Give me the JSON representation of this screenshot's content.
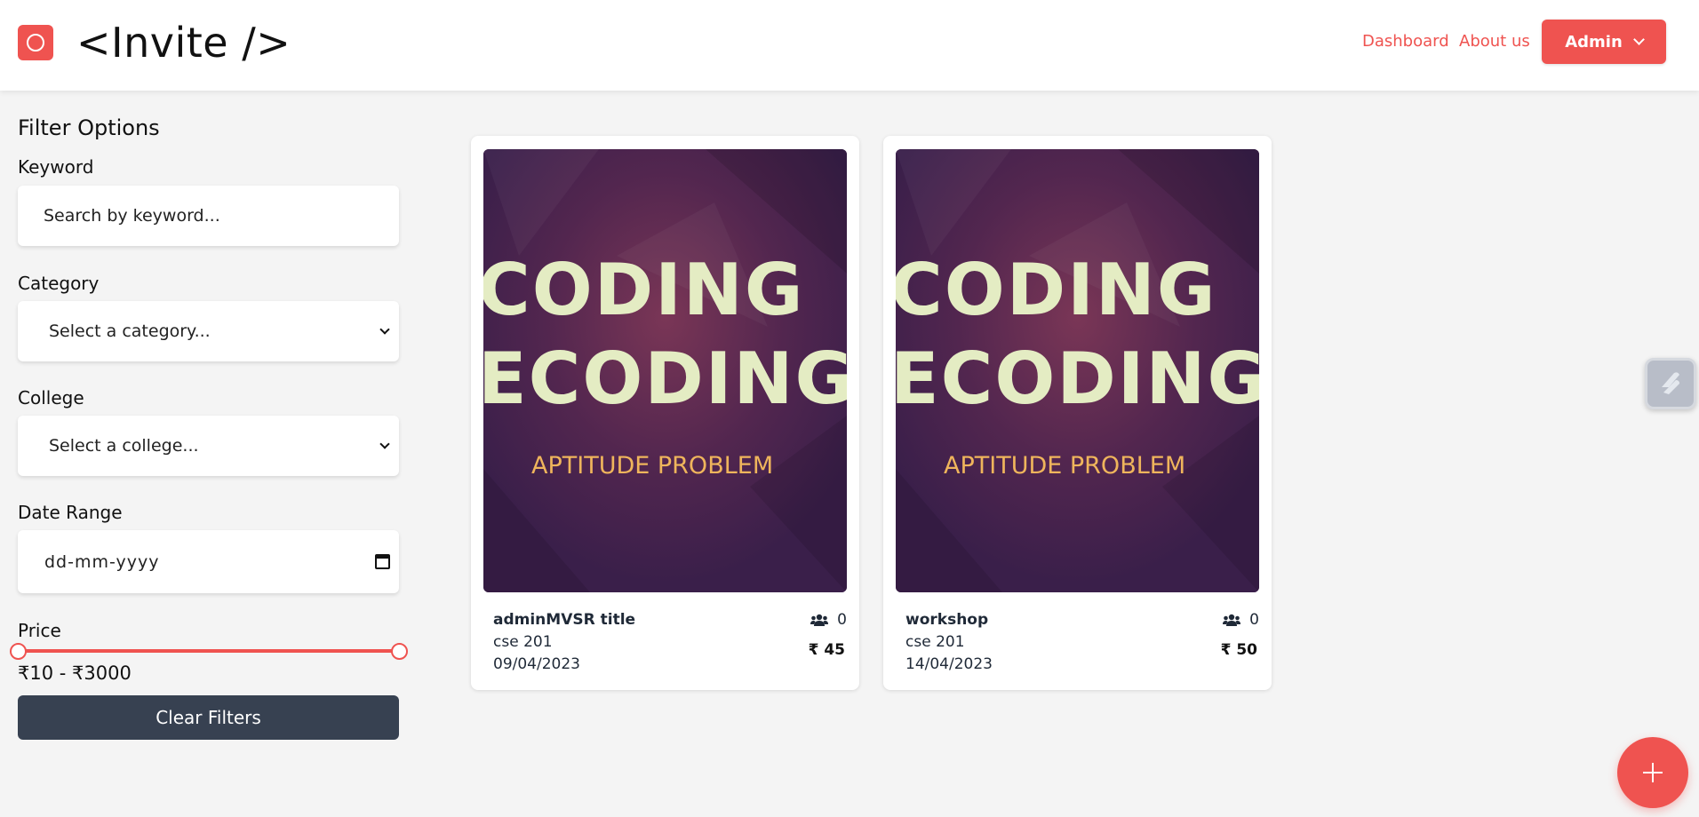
{
  "header": {
    "brand": "<Invite />",
    "nav": {
      "dashboard": "Dashboard",
      "about": "About us"
    },
    "admin_button": "Admin",
    "accent_color": "#ef5350"
  },
  "filters": {
    "title": "Filter Options",
    "keyword": {
      "label": "Keyword",
      "placeholder": "Search by keyword..."
    },
    "category": {
      "label": "Category",
      "selected": "Select a category..."
    },
    "college": {
      "label": "College",
      "selected": "Select a college..."
    },
    "date": {
      "label": "Date Range",
      "placeholder": "dd-mm-yyyy"
    },
    "price": {
      "label": "Price",
      "range_text": "₹10 - ₹3000",
      "min": 10,
      "max": 3000
    },
    "clear_button": "Clear Filters",
    "clear_button_color": "#374151"
  },
  "events": [
    {
      "image": {
        "line1": "CODING",
        "line2": "ECODING",
        "line3": "APTITUDE PROBLEM"
      },
      "title": "adminMVSR title",
      "location": "cse 201",
      "date": "09/04/2023",
      "attendees": "0",
      "price": "₹ 45"
    },
    {
      "image": {
        "line1": "CODING",
        "line2": "ECODING",
        "line3": "APTITUDE PROBLEM"
      },
      "title": "workshop",
      "location": "cse 201",
      "date": "14/04/2023",
      "attendees": "0",
      "price": "₹ 50"
    }
  ],
  "icons": {
    "logo": "circle-logo-icon",
    "people": "users-icon",
    "calendar": "calendar-icon",
    "fab": "plus-icon",
    "widget": "extension-widget-icon"
  }
}
